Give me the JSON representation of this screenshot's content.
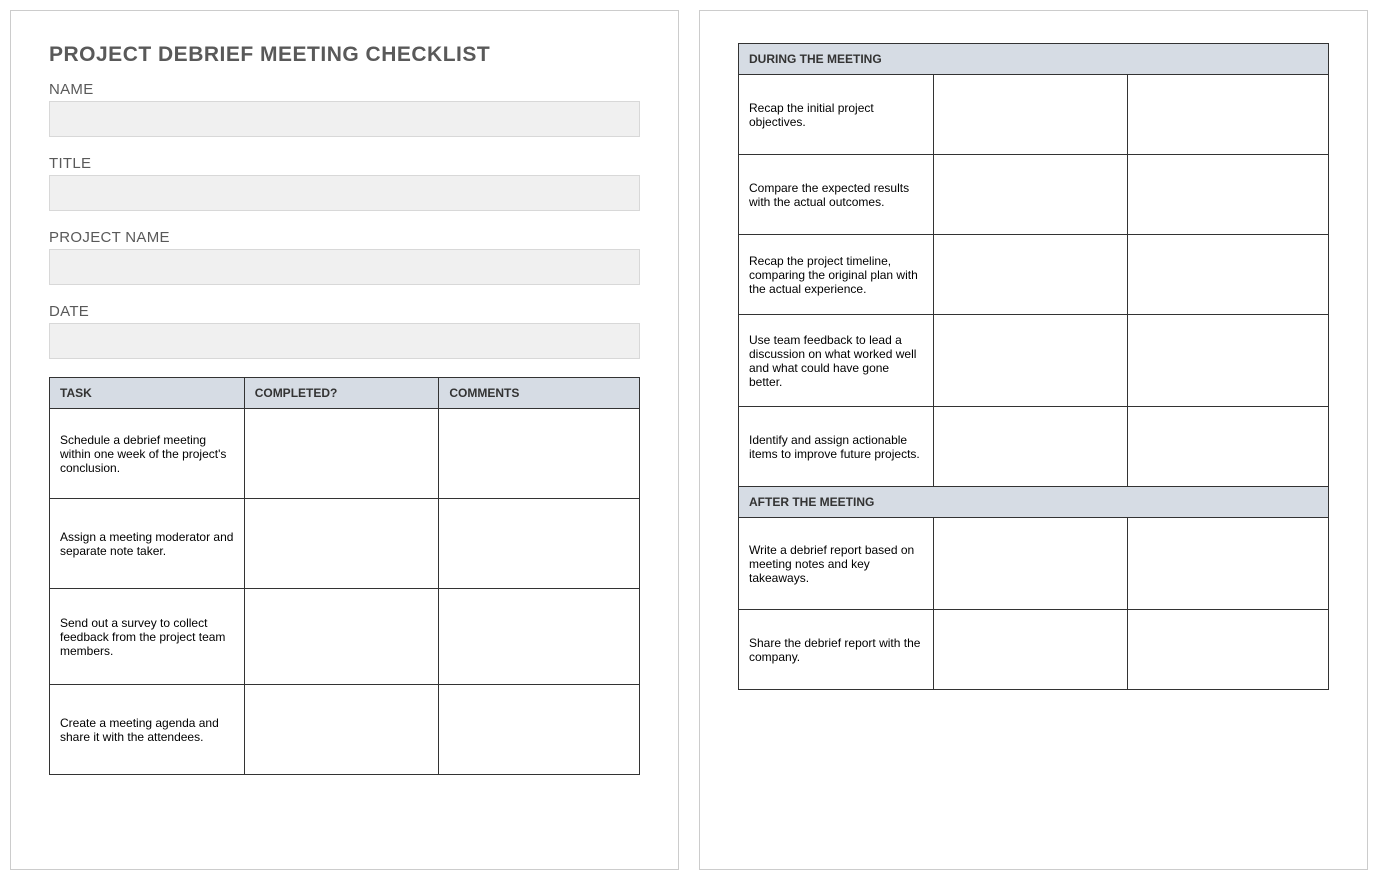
{
  "documentTitle": "PROJECT DEBRIEF MEETING CHECKLIST",
  "fields": {
    "name": {
      "label": "NAME",
      "value": ""
    },
    "title": {
      "label": "TITLE",
      "value": ""
    },
    "projectName": {
      "label": "PROJECT NAME",
      "value": ""
    },
    "date": {
      "label": "DATE",
      "value": ""
    }
  },
  "table": {
    "headers": {
      "task": "TASK",
      "completed": "COMPLETED?",
      "comments": "COMMENTS"
    },
    "sections": [
      {
        "title": null,
        "rows": [
          {
            "task": "Schedule a debrief meeting within one week of the project's conclusion.",
            "completed": "",
            "comments": ""
          },
          {
            "task": "Assign a meeting moderator and separate note taker.",
            "completed": "",
            "comments": ""
          },
          {
            "task": "Send out a survey to collect feedback from the project team members.",
            "completed": "",
            "comments": ""
          },
          {
            "task": "Create a meeting agenda and share it with the attendees.",
            "completed": "",
            "comments": ""
          }
        ]
      },
      {
        "title": "DURING THE MEETING",
        "rows": [
          {
            "task": "Recap the initial project objectives.",
            "completed": "",
            "comments": ""
          },
          {
            "task": "Compare the expected results with the actual outcomes.",
            "completed": "",
            "comments": ""
          },
          {
            "task": "Recap the project timeline, comparing the original plan with the actual experience.",
            "completed": "",
            "comments": ""
          },
          {
            "task": "Use team feedback to lead a discussion on what worked well and what could have gone better.",
            "completed": "",
            "comments": ""
          },
          {
            "task": "Identify and assign actionable items to improve future projects.",
            "completed": "",
            "comments": ""
          }
        ]
      },
      {
        "title": "AFTER THE MEETING",
        "rows": [
          {
            "task": "Write a debrief report based on meeting notes and key takeaways.",
            "completed": "",
            "comments": ""
          },
          {
            "task": "Share the debrief report with the company.",
            "completed": "",
            "comments": ""
          }
        ]
      }
    ]
  }
}
